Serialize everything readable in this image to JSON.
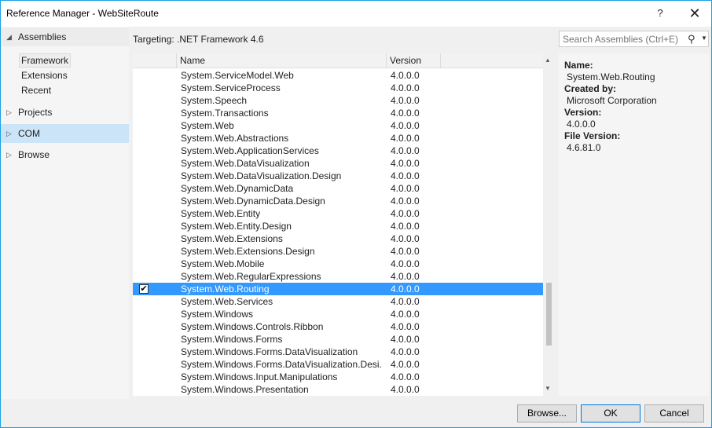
{
  "window": {
    "title": "Reference Manager - WebSiteRoute",
    "help_label": "?",
    "close_label": "✕"
  },
  "nav": {
    "assemblies": "Assemblies",
    "framework": "Framework",
    "extensions": "Extensions",
    "recent": "Recent",
    "projects": "Projects",
    "com": "COM",
    "browse": "Browse"
  },
  "targeting": "Targeting: .NET Framework 4.6",
  "list": {
    "columns": {
      "name": "Name",
      "version": "Version"
    },
    "rows": [
      {
        "name": "System.ServiceModel.Web",
        "version": "4.0.0.0",
        "checked": false,
        "selected": false
      },
      {
        "name": "System.ServiceProcess",
        "version": "4.0.0.0",
        "checked": false,
        "selected": false
      },
      {
        "name": "System.Speech",
        "version": "4.0.0.0",
        "checked": false,
        "selected": false
      },
      {
        "name": "System.Transactions",
        "version": "4.0.0.0",
        "checked": false,
        "selected": false
      },
      {
        "name": "System.Web",
        "version": "4.0.0.0",
        "checked": false,
        "selected": false
      },
      {
        "name": "System.Web.Abstractions",
        "version": "4.0.0.0",
        "checked": false,
        "selected": false
      },
      {
        "name": "System.Web.ApplicationServices",
        "version": "4.0.0.0",
        "checked": false,
        "selected": false
      },
      {
        "name": "System.Web.DataVisualization",
        "version": "4.0.0.0",
        "checked": false,
        "selected": false
      },
      {
        "name": "System.Web.DataVisualization.Design",
        "version": "4.0.0.0",
        "checked": false,
        "selected": false
      },
      {
        "name": "System.Web.DynamicData",
        "version": "4.0.0.0",
        "checked": false,
        "selected": false
      },
      {
        "name": "System.Web.DynamicData.Design",
        "version": "4.0.0.0",
        "checked": false,
        "selected": false
      },
      {
        "name": "System.Web.Entity",
        "version": "4.0.0.0",
        "checked": false,
        "selected": false
      },
      {
        "name": "System.Web.Entity.Design",
        "version": "4.0.0.0",
        "checked": false,
        "selected": false
      },
      {
        "name": "System.Web.Extensions",
        "version": "4.0.0.0",
        "checked": false,
        "selected": false
      },
      {
        "name": "System.Web.Extensions.Design",
        "version": "4.0.0.0",
        "checked": false,
        "selected": false
      },
      {
        "name": "System.Web.Mobile",
        "version": "4.0.0.0",
        "checked": false,
        "selected": false
      },
      {
        "name": "System.Web.RegularExpressions",
        "version": "4.0.0.0",
        "checked": false,
        "selected": false
      },
      {
        "name": "System.Web.Routing",
        "version": "4.0.0.0",
        "checked": true,
        "selected": true
      },
      {
        "name": "System.Web.Services",
        "version": "4.0.0.0",
        "checked": false,
        "selected": false
      },
      {
        "name": "System.Windows",
        "version": "4.0.0.0",
        "checked": false,
        "selected": false
      },
      {
        "name": "System.Windows.Controls.Ribbon",
        "version": "4.0.0.0",
        "checked": false,
        "selected": false
      },
      {
        "name": "System.Windows.Forms",
        "version": "4.0.0.0",
        "checked": false,
        "selected": false
      },
      {
        "name": "System.Windows.Forms.DataVisualization",
        "version": "4.0.0.0",
        "checked": false,
        "selected": false
      },
      {
        "name": "System.Windows.Forms.DataVisualization.Desi...",
        "version": "4.0.0.0",
        "checked": false,
        "selected": false
      },
      {
        "name": "System.Windows.Input.Manipulations",
        "version": "4.0.0.0",
        "checked": false,
        "selected": false
      },
      {
        "name": "System.Windows.Presentation",
        "version": "4.0.0.0",
        "checked": false,
        "selected": false
      }
    ]
  },
  "search": {
    "placeholder": "Search Assemblies (Ctrl+E)"
  },
  "details": {
    "name_label": "Name:",
    "name_value": "System.Web.Routing",
    "created_label": "Created by:",
    "created_value": "Microsoft Corporation",
    "version_label": "Version:",
    "version_value": "4.0.0.0",
    "file_version_label": "File Version:",
    "file_version_value": "4.6.81.0"
  },
  "buttons": {
    "browse": "Browse...",
    "ok": "OK",
    "cancel": "Cancel"
  },
  "colors": {
    "selection": "#3399ff",
    "nav_highlight": "#cce4f7",
    "window_border": "#1ba1e2"
  }
}
